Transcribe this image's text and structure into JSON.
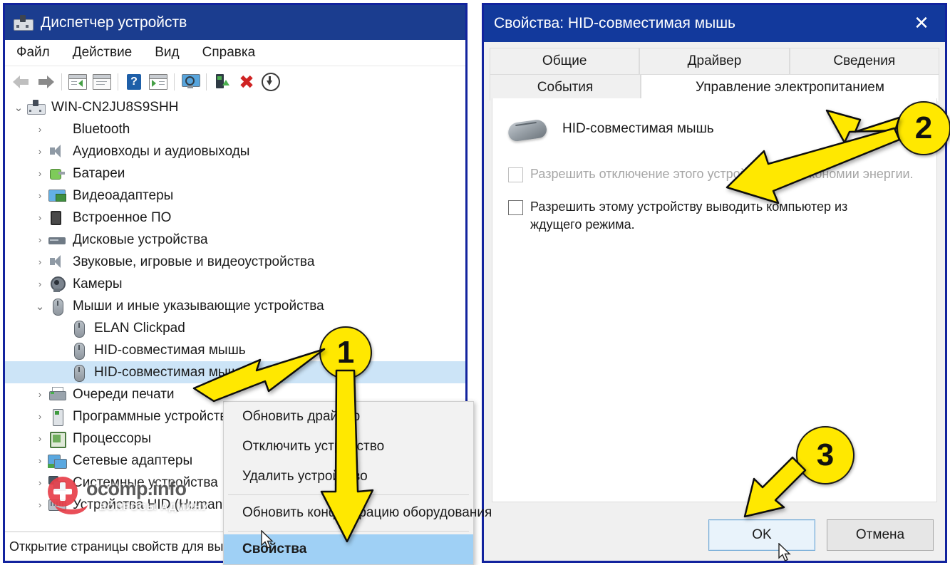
{
  "device_manager": {
    "title": "Диспетчер устройств",
    "menu": [
      "Файл",
      "Действие",
      "Вид",
      "Справка"
    ],
    "toolbar_icons": [
      "back-arrow-icon",
      "forward-arrow-icon",
      "show-hide-tree-icon",
      "properties-icon",
      "help-icon",
      "scan-icon",
      "monitor-icon",
      "eject-device-icon",
      "uninstall-device-icon",
      "update-driver-icon"
    ],
    "tree": [
      {
        "label": "WIN-CN2JU8S9SHH",
        "indent": 0,
        "chev": "expanded",
        "icon": "computer-icon"
      },
      {
        "label": "Bluetooth",
        "indent": 1,
        "chev": "collapsed",
        "icon": "bluetooth-icon"
      },
      {
        "label": "Аудиовходы и аудиовыходы",
        "indent": 1,
        "chev": "collapsed",
        "icon": "speaker-icon"
      },
      {
        "label": "Батареи",
        "indent": 1,
        "chev": "collapsed",
        "icon": "battery-icon"
      },
      {
        "label": "Видеоадаптеры",
        "indent": 1,
        "chev": "collapsed",
        "icon": "display-adapter-icon"
      },
      {
        "label": "Встроенное ПО",
        "indent": 1,
        "chev": "collapsed",
        "icon": "firmware-chip-icon"
      },
      {
        "label": "Дисковые устройства",
        "indent": 1,
        "chev": "collapsed",
        "icon": "disk-drive-icon"
      },
      {
        "label": "Звуковые, игровые и видеоустройства",
        "indent": 1,
        "chev": "collapsed",
        "icon": "speaker-icon"
      },
      {
        "label": "Камеры",
        "indent": 1,
        "chev": "collapsed",
        "icon": "camera-icon"
      },
      {
        "label": "Мыши и иные указывающие устройства",
        "indent": 1,
        "chev": "expanded",
        "icon": "mouse-icon"
      },
      {
        "label": "ELAN Clickpad",
        "indent": 2,
        "chev": "none",
        "icon": "mouse-icon"
      },
      {
        "label": "HID-совместимая мышь",
        "indent": 2,
        "chev": "none",
        "icon": "mouse-icon"
      },
      {
        "label": "HID-совместимая мышь",
        "indent": 2,
        "chev": "none",
        "icon": "mouse-icon",
        "selected": true
      },
      {
        "label": "Очереди печати",
        "indent": 1,
        "chev": "collapsed",
        "icon": "printer-icon"
      },
      {
        "label": "Программные устройства",
        "indent": 1,
        "chev": "collapsed",
        "icon": "software-device-icon"
      },
      {
        "label": "Процессоры",
        "indent": 1,
        "chev": "collapsed",
        "icon": "cpu-icon"
      },
      {
        "label": "Сетевые адаптеры",
        "indent": 1,
        "chev": "collapsed",
        "icon": "network-adapter-icon"
      },
      {
        "label": "Системные устройства",
        "indent": 1,
        "chev": "collapsed",
        "icon": "system-device-icon"
      },
      {
        "label": "Устройства HID (Human Interface Devices)",
        "indent": 1,
        "chev": "collapsed",
        "icon": "hid-keyboard-icon"
      }
    ],
    "context_menu": [
      {
        "label": "Обновить драйвер"
      },
      {
        "label": "Отключить устройство"
      },
      {
        "label": "Удалить устройство"
      },
      {
        "separator": true
      },
      {
        "label": "Обновить конфигурацию оборудования"
      },
      {
        "separator": true
      },
      {
        "label": "Свойства",
        "highlighted": true
      }
    ],
    "status_bar": "Открытие страницы свойств для выделенного объекта."
  },
  "watermark": {
    "main": "ocomp.info",
    "sub": "ВОПРОСЫ АДМИНУ"
  },
  "properties_dialog": {
    "title": "Свойства: HID-совместимая мышь",
    "close_label": "✕",
    "tabs_row1": [
      {
        "label": "Общие",
        "active": false
      },
      {
        "label": "Драйвер",
        "active": false
      },
      {
        "label": "Сведения",
        "active": false
      }
    ],
    "tabs_row2": [
      {
        "label": "События",
        "active": false
      },
      {
        "label": "Управление электропитанием",
        "active": true
      }
    ],
    "device_name": "HID-совместимая мышь",
    "checkboxes": [
      {
        "label": "Разрешить отключение этого устройства для экономии энергии.",
        "checked": false,
        "disabled": true
      },
      {
        "label": "Разрешить этому устройству выводить компьютер из ждущего режима.",
        "checked": false,
        "disabled": false
      }
    ],
    "buttons": [
      {
        "label": "OK",
        "default": true
      },
      {
        "label": "Отмена",
        "default": false
      }
    ]
  },
  "annotations": {
    "badges": [
      "1",
      "2",
      "3"
    ],
    "accent_color": "#ffe800",
    "window_border_color": "#12239e",
    "titlebar_color": "#1b3d8f",
    "selection_color": "#cce4f7"
  }
}
